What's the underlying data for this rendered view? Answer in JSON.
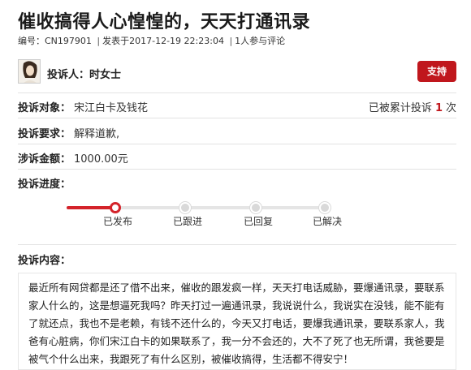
{
  "title": "催收搞得人心惶惶的，天天打通讯录",
  "meta": {
    "id_label": "编号：",
    "id_value": "CN197901",
    "published": "发表于2017-12-19 22:23:04",
    "participants": "1人参与评论"
  },
  "complainant": {
    "label": "投诉人：时女士",
    "support_button": "支持"
  },
  "fields": {
    "target_label": "投诉对象：",
    "target_value": "宋江白卡及钱花",
    "count_prefix": "已被累计投诉",
    "count_value": "1",
    "count_suffix": "次",
    "request_label": "投诉要求：",
    "request_value": "解释道歉,",
    "amount_label": "涉诉金额：",
    "amount_value": "1000.00元",
    "progress_label": "投诉进度："
  },
  "progress": {
    "current_step": 1,
    "steps": [
      "已发布",
      "已跟进",
      "已回复",
      "已解决"
    ]
  },
  "content": {
    "label": "投诉内容：",
    "text": "最近所有网贷都是还了借不出来，催收的跟发疯一样，天天打电话威胁，要爆通讯录，要联系家人什么的，这是想逼死我吗？昨天打过一遍通讯录，我说说什么，我说实在没钱，能不能有了就还点，我也不是老赖，有钱不还什么的，今天又打电话，要爆我通讯录，要联系家人，我爸有心脏病，你们宋江白卡的如果联系了，我一分不会还的，大不了死了也无所谓，我爸要是被气个什么出来，我跟死了有什么区别，被催收搞得，生活都不得安宁！"
  },
  "colors": {
    "accent": "#c0171d",
    "progress_active": "#d4232a"
  }
}
